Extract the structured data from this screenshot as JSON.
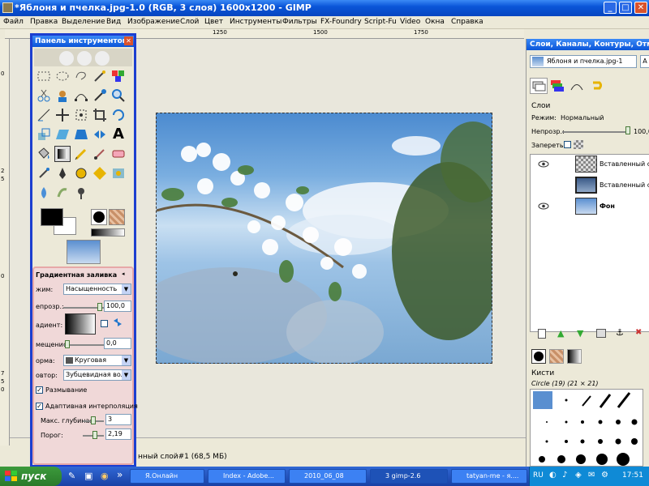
{
  "window": {
    "title": "*Яблоня и пчелка.jpg-1.0 (RGB, 3 слоя) 1600x1200 - GIMP",
    "minimize": "_",
    "maximize": "□",
    "close": "✕"
  },
  "menu": [
    "Файл",
    "Правка",
    "Выделение",
    "Вид",
    "Изображение",
    "Слой",
    "Цвет",
    "Инструменты",
    "Фильтры",
    "FX-Foundry",
    "Script-Fu",
    "Video",
    "Окна",
    "Справка"
  ],
  "ruler": {
    "h": [
      "1250",
      "1500",
      "1750"
    ],
    "v": [
      "0",
      "2",
      "5",
      "0",
      "7",
      "5",
      "0"
    ]
  },
  "status": {
    "text": "нный слой#1 (68,5 МБ)"
  },
  "toolbox": {
    "title": "Панель инструментов",
    "close": "✕",
    "options": {
      "title": "Градиентная заливка",
      "mode_label": "жим:",
      "mode_value": "Насыщенность",
      "opacity_label": "епрозр.:",
      "opacity_value": "100,0",
      "gradient_label": "адиент:",
      "offset_label": "мещение:",
      "offset_value": "0,0",
      "shape_label": "орма:",
      "shape_value": "Круговая",
      "repeat_label": "овтор:",
      "repeat_value": "Зубцевидная волна",
      "dither_label": "Размывание",
      "adaptive_label": "Адаптивная интерполяция",
      "depth_label": "Макс. глубина:",
      "depth_value": "3",
      "threshold_label": "Порог:",
      "threshold_value": "2,19"
    }
  },
  "dock": {
    "title": "Слои, Каналы, Контуры, Отмени...",
    "image_select": "Яблоня и пчелка.jpg-1",
    "auto_label": "А",
    "section": "Слои",
    "mode_label": "Режим:",
    "mode_value": "Нормальный",
    "opacity_label": "Непрозр.:",
    "opacity_value": "100,0",
    "lock_label": "Запереть:",
    "layers": [
      {
        "name": "Вставленный слой",
        "visible": true
      },
      {
        "name": "Вставленный слой",
        "visible": false
      },
      {
        "name": "Фон",
        "visible": true
      }
    ],
    "brushes_title": "Кисти",
    "brush_name": "Circle (19) (21 × 21)"
  },
  "taskbar": {
    "start": "пуск",
    "buttons": [
      "Я.Онлайн",
      "Index - Adobe...",
      "2010_06_08",
      "3 gimp-2.6",
      "tatyan-me - я...."
    ],
    "lang": "RU",
    "clock": "17:51"
  },
  "colors": {
    "accent": "#1c3fd0",
    "titlebar": "#0a55d8",
    "options_bg": "#f0d8d8"
  }
}
